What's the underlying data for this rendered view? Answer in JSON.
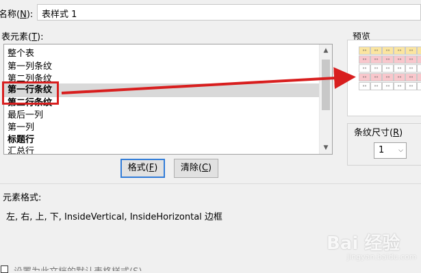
{
  "dialog": {
    "name_label": "名称(",
    "name_key": "N",
    "name_label_end": "):",
    "name_value": "表样式 1",
    "elements_label": "表元素(",
    "elements_key": "T",
    "elements_label_end": "):",
    "elements": [
      {
        "label": "整个表",
        "bold": false
      },
      {
        "label": "第一列条纹",
        "bold": false
      },
      {
        "label": "第二列条纹",
        "bold": false
      },
      {
        "label": "第一行条纹",
        "bold": true,
        "selected": true
      },
      {
        "label": "第二行条纹",
        "bold": true
      },
      {
        "label": "最后一列",
        "bold": false
      },
      {
        "label": "第一列",
        "bold": false
      },
      {
        "label": "标题行",
        "bold": true
      },
      {
        "label": "汇总行",
        "bold": false
      }
    ],
    "format_button": "格式(",
    "format_key": "F",
    "clear_button": "清除(",
    "clear_key": "C",
    "button_end": ")",
    "preview_label": "预览",
    "band_size_label": "条纹尺寸(",
    "band_size_key": "R",
    "band_size_end": ")",
    "band_size_value": "1",
    "element_format_label": "元素格式:",
    "element_format_value": "左, 右, 上, 下, InsideVertical, InsideHorizontal 边框",
    "bottom_checkbox_label": "设置为此文档的默认表格样式(S)"
  },
  "colors": {
    "highlight": "#d81e1e",
    "header_row": "#fbe5a0",
    "band_row": "#f9c7cc",
    "plain_row": "#ffffff"
  },
  "watermark": {
    "text": "Bai 经验",
    "sub": "jingyan.baidu.com"
  }
}
